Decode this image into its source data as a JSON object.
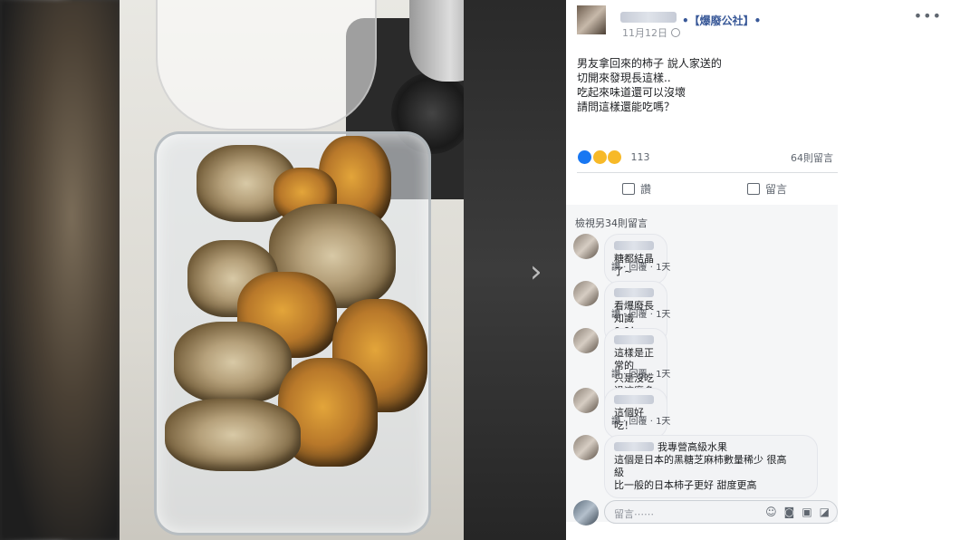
{
  "post": {
    "group_name": "•【爆廢公社】•",
    "date": "11月12日",
    "text_lines": [
      "男友拿回來的柿子 說人家送的",
      "切開來發現長這樣..",
      "吃起來味道還可以沒壞",
      "請問這樣還能吃嗎？"
    ],
    "reaction_count": "113",
    "comment_count": "64則留言",
    "like_label": "讚",
    "comment_label": "留言"
  },
  "comments_section": {
    "view_more": "檢視另34則留言",
    "comments": [
      {
        "lines": [
          "糖都結晶了~"
        ],
        "reply": "讚 · 回覆 · 1天"
      },
      {
        "lines": [
          "看爆廢長知識0.0！"
        ],
        "reply": "讚 · 回覆 · 1天"
      },
      {
        "lines": [
          "這樣是正常的",
          "只是沒吃過這麼多長這樣的"
        ],
        "reply": "讚 · 回覆 · 1天"
      },
      {
        "lines": [
          "這個好吃！"
        ],
        "reply": "讚 · 回覆 · 1天"
      },
      {
        "lines": [
          "我專營高級水果",
          "這個是日本的黑糖芝麻柿數量稀少 很高",
          "級",
          "比一般的日本柿子更好 甜度更高"
        ],
        "reply": ""
      }
    ],
    "reply_placeholder": "留言⋯⋯"
  },
  "icons": [
    "more-icon",
    "globe-icon",
    "like-icon",
    "comment-icon",
    "emoji-icon",
    "camera-icon",
    "gif-icon",
    "sticker-icon",
    "next-arrow-icon"
  ],
  "colors": {
    "link": "#385898",
    "text": "#1c1e21",
    "muted": "#90949c",
    "panel": "#ffffff",
    "comment_bg": "#f5f6f7"
  }
}
